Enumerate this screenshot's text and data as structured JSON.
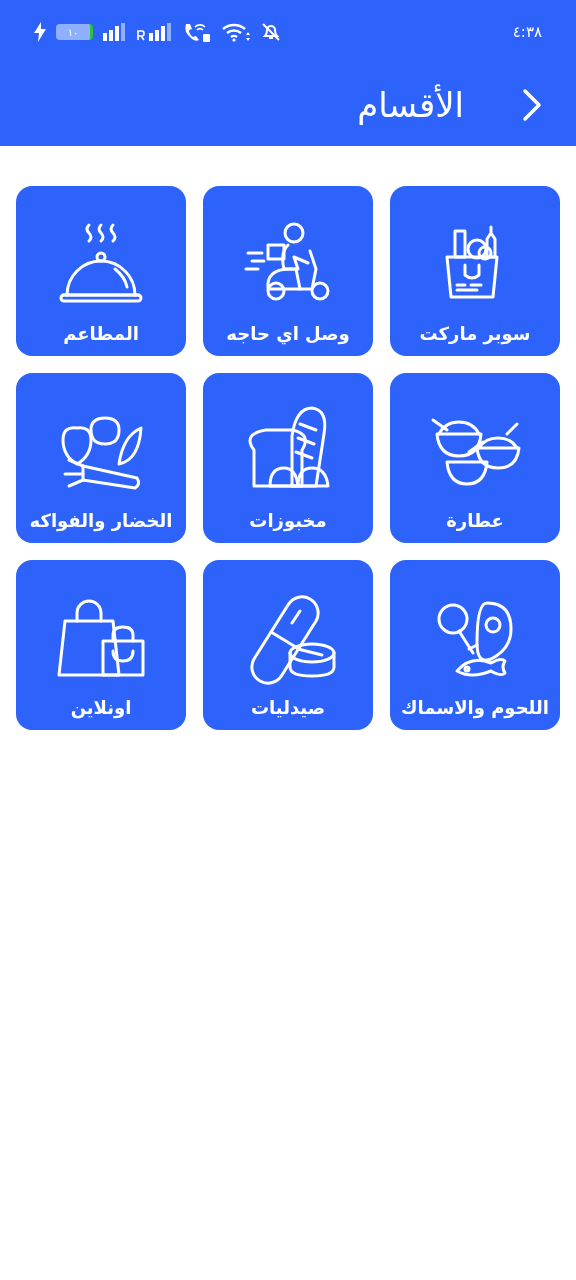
{
  "status_bar": {
    "time": "٤:٣٨",
    "battery": "١٠"
  },
  "header": {
    "title": "الأقسام"
  },
  "categories": [
    {
      "label": "سوبر ماركت",
      "kind": "supermarket"
    },
    {
      "label": "وصل اي حاجه",
      "kind": "delivery"
    },
    {
      "label": "المطاعم",
      "kind": "restaurant"
    },
    {
      "label": "عطارة",
      "kind": "spices"
    },
    {
      "label": "مخبوزات",
      "kind": "bakery"
    },
    {
      "label": "الخضار والفواكه",
      "kind": "produce"
    },
    {
      "label": "اللحوم والاسماك",
      "kind": "meat"
    },
    {
      "label": "صيدليات",
      "kind": "pharmacy"
    },
    {
      "label": "اونلاين",
      "kind": "online"
    }
  ]
}
